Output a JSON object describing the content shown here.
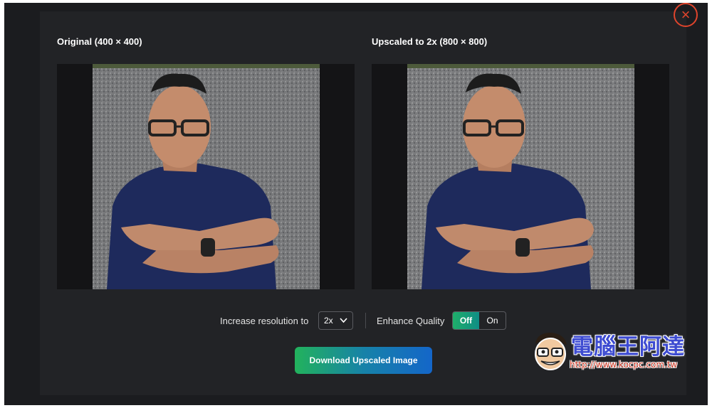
{
  "dialog": {
    "close_icon": "close-icon",
    "original_title": "Original (400 × 400)",
    "upscaled_title": "Upscaled to 2x (800 × 800)",
    "controls": {
      "resolution_label": "Increase resolution to",
      "resolution_value": "2x",
      "enhance_label": "Enhance Quality",
      "toggle_off": "Off",
      "toggle_on": "On",
      "toggle_selected": "Off"
    },
    "download_label": "Download Upscaled Image"
  },
  "watermark": {
    "text": "電腦王阿達",
    "url": "http://www.kocpc.com.tw"
  },
  "colors": {
    "background": "#1b1c1f",
    "dialog": "#222326",
    "close": "#e0442c",
    "toggle_active": "#1fae6a",
    "download_start": "#22b25c",
    "download_end": "#1466c9"
  }
}
